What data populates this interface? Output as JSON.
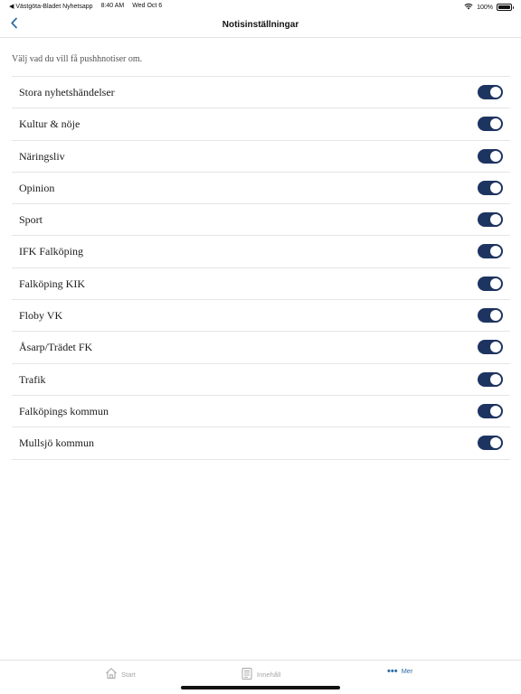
{
  "status_bar": {
    "back_app": "◀ Västgöta-Bladet Nyhetsapp",
    "time": "8:40 AM",
    "date": "Wed Oct 6",
    "battery": "100%",
    "battery_level": 1.0,
    "icons": [
      "wifi-icon",
      "battery-icon"
    ]
  },
  "nav": {
    "back_icon": "chevron-left-icon",
    "title": "Notisinställningar"
  },
  "description": "Välj vad du vill få pushhnotiser om.",
  "settings": [
    {
      "label": "Stora nyhetshändelser",
      "enabled": true
    },
    {
      "label": "Kultur & nöje",
      "enabled": true
    },
    {
      "label": "Näringsliv",
      "enabled": true
    },
    {
      "label": "Opinion",
      "enabled": true
    },
    {
      "label": "Sport",
      "enabled": true
    },
    {
      "label": "IFK Falköping",
      "enabled": true
    },
    {
      "label": "Falköping KIK",
      "enabled": true
    },
    {
      "label": "Floby VK",
      "enabled": true
    },
    {
      "label": "Åsarp/Trädet FK",
      "enabled": true
    },
    {
      "label": "Trafik",
      "enabled": true
    },
    {
      "label": "Falköpings kommun",
      "enabled": true
    },
    {
      "label": "Mullsjö kommun",
      "enabled": true
    }
  ],
  "tab_bar": {
    "start": "Start",
    "innehall": "Innehåll",
    "mer": "Mer",
    "active": "mer",
    "icons": [
      "house-icon",
      "document-list-icon",
      "more-dots-icon"
    ]
  },
  "colors": {
    "toggle_on": "#1d3461",
    "active_tab": "#2f6ea7",
    "back_chevron": "#2f6ea7"
  }
}
